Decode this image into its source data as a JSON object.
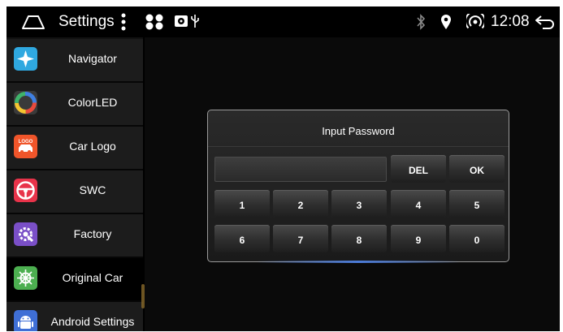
{
  "statusbar": {
    "title": "Settings",
    "time": "12:08",
    "icons": [
      "home-icon",
      "more-vert-icon",
      "app-switch-icon",
      "radio-icon",
      "usb-icon",
      "bluetooth-icon",
      "location-icon",
      "hotspot-icon",
      "back-icon"
    ]
  },
  "sidebar": {
    "items": [
      {
        "label": "Navigator",
        "icon": "compass-icon",
        "color": "#2fa8e0"
      },
      {
        "label": "ColorLED",
        "icon": "color-wheel-icon",
        "color": "#3a3a3a"
      },
      {
        "label": "Car Logo",
        "icon": "car-logo-icon",
        "color": "#f0552a",
        "badge": "LOGO"
      },
      {
        "label": "SWC",
        "icon": "steering-wheel-icon",
        "color": "#e8334a"
      },
      {
        "label": "Factory",
        "icon": "factory-gear-icon",
        "color": "#7a4fc7"
      },
      {
        "label": "Original Car",
        "icon": "original-car-icon",
        "color": "#4caf50",
        "active": true
      },
      {
        "label": "Android Settings",
        "icon": "android-icon",
        "color": "#3f6fd6"
      }
    ]
  },
  "dialog": {
    "title": "Input Password",
    "password_value": "",
    "keys": {
      "del": "DEL",
      "ok": "OK",
      "row1": [
        "1",
        "2",
        "3",
        "4",
        "5"
      ],
      "row2": [
        "6",
        "7",
        "8",
        "9",
        "0"
      ]
    }
  }
}
